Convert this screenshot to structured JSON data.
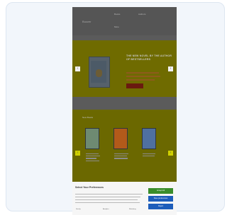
{
  "header": {
    "logo": "Buzzer",
    "nav": [
      "Books",
      "Authors",
      "More"
    ]
  },
  "hero": {
    "title": "THE NEW NOVEL BY THE AUTHOR OF BESTSELLERS",
    "button_label": "Buy now"
  },
  "books": {
    "section_title": "New Books",
    "items": [
      {
        "cover_color": "#6e8a72"
      },
      {
        "cover_color": "#b25a1a"
      },
      {
        "cover_color": "#4f709f"
      }
    ]
  },
  "cookie": {
    "title": "Select Your Preferences",
    "accept_button": "Accept All",
    "save_button": "Save preferences",
    "reject_button": "Reject",
    "toggles": [
      "Strictly",
      "Analytics",
      "Marketing"
    ]
  },
  "colors": {
    "hero_bg": "#6f6b00",
    "cookie_accept": "#3a8d2b",
    "cookie_secondary": "#1d5dbb"
  }
}
